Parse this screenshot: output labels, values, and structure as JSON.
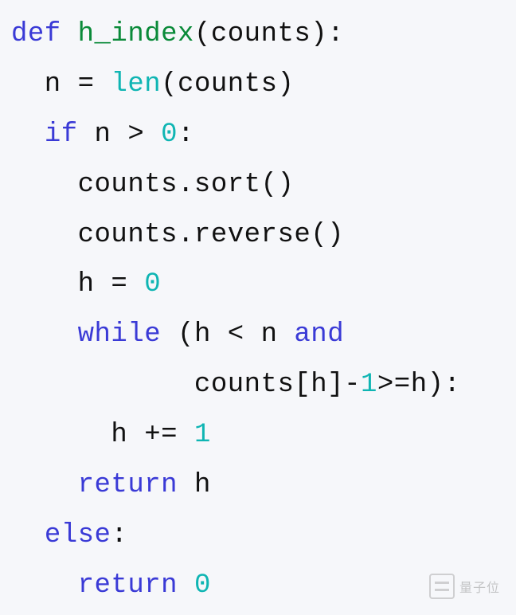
{
  "language": "python",
  "watermark_text": "量子位",
  "tokens": [
    {
      "t": "def ",
      "c": "tok-kw"
    },
    {
      "t": "h_index",
      "c": "tok-fn"
    },
    {
      "t": "(counts)",
      "c": "tok-id"
    },
    {
      "t": ":",
      "c": "tok-op"
    },
    {
      "t": "\n",
      "c": ""
    },
    {
      "t": "  n ",
      "c": "tok-id"
    },
    {
      "t": "= ",
      "c": "tok-op"
    },
    {
      "t": "len",
      "c": "tok-bi"
    },
    {
      "t": "(counts)",
      "c": "tok-id"
    },
    {
      "t": "\n",
      "c": ""
    },
    {
      "t": "  ",
      "c": ""
    },
    {
      "t": "if",
      "c": "tok-kw"
    },
    {
      "t": " n ",
      "c": "tok-id"
    },
    {
      "t": "> ",
      "c": "tok-op"
    },
    {
      "t": "0",
      "c": "tok-num"
    },
    {
      "t": ":",
      "c": "tok-op"
    },
    {
      "t": "\n",
      "c": ""
    },
    {
      "t": "    counts.sort()",
      "c": "tok-id"
    },
    {
      "t": "\n",
      "c": ""
    },
    {
      "t": "    counts.reverse()",
      "c": "tok-id"
    },
    {
      "t": "\n",
      "c": ""
    },
    {
      "t": "    h ",
      "c": "tok-id"
    },
    {
      "t": "= ",
      "c": "tok-op"
    },
    {
      "t": "0",
      "c": "tok-num"
    },
    {
      "t": "\n",
      "c": ""
    },
    {
      "t": "    ",
      "c": ""
    },
    {
      "t": "while",
      "c": "tok-kw"
    },
    {
      "t": " (h ",
      "c": "tok-id"
    },
    {
      "t": "< ",
      "c": "tok-op"
    },
    {
      "t": "n ",
      "c": "tok-id"
    },
    {
      "t": "and",
      "c": "tok-kw"
    },
    {
      "t": "\n",
      "c": ""
    },
    {
      "t": "           counts[h]-",
      "c": "tok-id"
    },
    {
      "t": "1",
      "c": "tok-num"
    },
    {
      "t": ">=",
      "c": "tok-op"
    },
    {
      "t": "h)",
      "c": "tok-id"
    },
    {
      "t": ":",
      "c": "tok-op"
    },
    {
      "t": "\n",
      "c": ""
    },
    {
      "t": "      h ",
      "c": "tok-id"
    },
    {
      "t": "+= ",
      "c": "tok-op"
    },
    {
      "t": "1",
      "c": "tok-num"
    },
    {
      "t": "\n",
      "c": ""
    },
    {
      "t": "    ",
      "c": ""
    },
    {
      "t": "return",
      "c": "tok-kw"
    },
    {
      "t": " h",
      "c": "tok-id"
    },
    {
      "t": "\n",
      "c": ""
    },
    {
      "t": "  ",
      "c": ""
    },
    {
      "t": "else",
      "c": "tok-kw"
    },
    {
      "t": ":",
      "c": "tok-op"
    },
    {
      "t": "\n",
      "c": ""
    },
    {
      "t": "    ",
      "c": ""
    },
    {
      "t": "return",
      "c": "tok-kw"
    },
    {
      "t": " ",
      "c": ""
    },
    {
      "t": "0",
      "c": "tok-num"
    }
  ]
}
